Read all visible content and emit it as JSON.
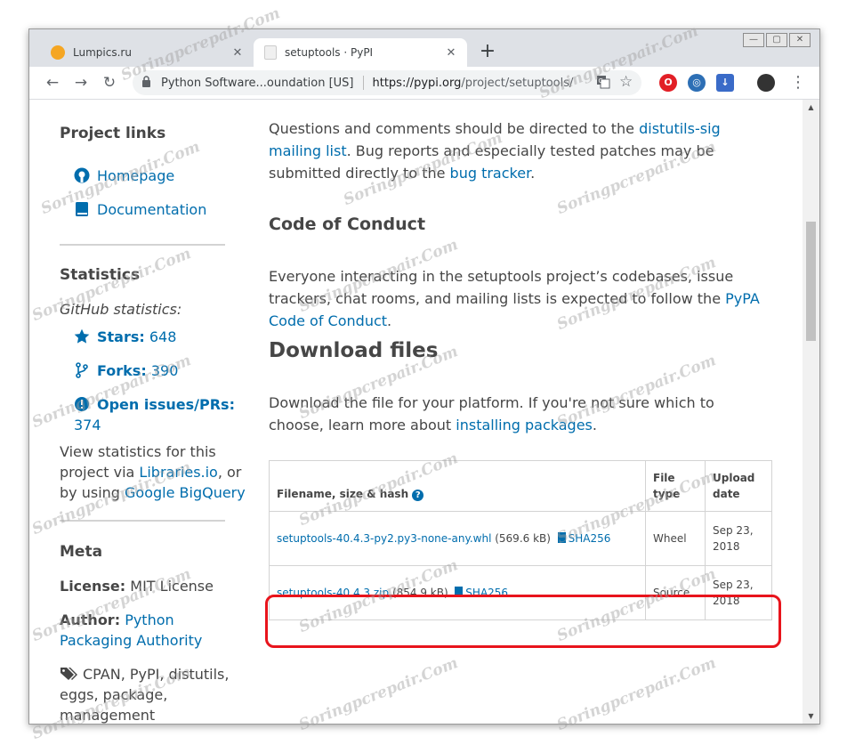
{
  "browser": {
    "tabs": [
      {
        "title": "Lumpics.ru",
        "active": false
      },
      {
        "title": "setuptools · PyPI",
        "active": true
      }
    ],
    "new_tab": "+",
    "ev_label": "Python Software...oundation [US]",
    "url_host": "https://pypi.org",
    "url_path": "/project/setuptools/"
  },
  "sidebar": {
    "project_links_title": "Project links",
    "homepage": "Homepage",
    "documentation": "Documentation",
    "statistics_title": "Statistics",
    "github_stats": "GitHub statistics:",
    "stars_label": "Stars:",
    "stars_value": "648",
    "forks_label": "Forks:",
    "forks_value": "390",
    "issues_label": "Open issues/PRs:",
    "issues_value": "374",
    "view_stats_1": "View statistics for this",
    "view_stats_2a": "project via ",
    "libraries_link": "Libraries.io",
    "view_stats_2b": ", or",
    "view_stats_3a": "by using ",
    "bigquery_link": "Google BigQuery",
    "meta_title": "Meta",
    "license_label": "License:",
    "license_value": " MIT License",
    "author_label": "Author:",
    "author_value_1": "Python",
    "author_value_2": "Packaging Authority",
    "tags_1": "CPAN, PyPI, distutils,",
    "tags_2": "eggs, package,",
    "tags_3": "management"
  },
  "main": {
    "para1_a": "Questions and comments should be directed to the ",
    "para1_link": "distutils-sig mailing list",
    "para1_b": ". Bug reports and especially tested patches may be submitted directly to the ",
    "para1_link2": "bug tracker",
    "para1_c": ".",
    "coc_title": "Code of Conduct",
    "coc_text_a": "Everyone interacting in the setuptools project’s codebases, issue trackers, chat rooms, and mailing lists is expected to follow the ",
    "coc_link": "PyPA Code of Conduct",
    "coc_text_b": ".",
    "download_title": "Download files",
    "download_text_a": "Download the file for your platform. If you're not sure which to choose, learn more about ",
    "download_link": "installing packages",
    "download_text_b": "."
  },
  "files_table": {
    "headers": [
      "Filename, size & hash",
      "File type",
      "Upload date"
    ],
    "rows": [
      {
        "filename": "setuptools-40.4.3-py2.py3-none-any.whl",
        "size": "(569.6 kB)",
        "hash": "SHA256",
        "type": "Wheel",
        "date": "Sep 23, 2018"
      },
      {
        "filename": "setuptools-40.4.3.zip",
        "size": "(854.9 kB)",
        "hash": "SHA256",
        "type": "Source",
        "date": "Sep 23, 2018"
      }
    ]
  },
  "watermark": "Soringpcrepair.Com",
  "colors": {
    "link": "#006dad",
    "highlight": "#e8141c",
    "tabstrip": "#dee1e6"
  }
}
